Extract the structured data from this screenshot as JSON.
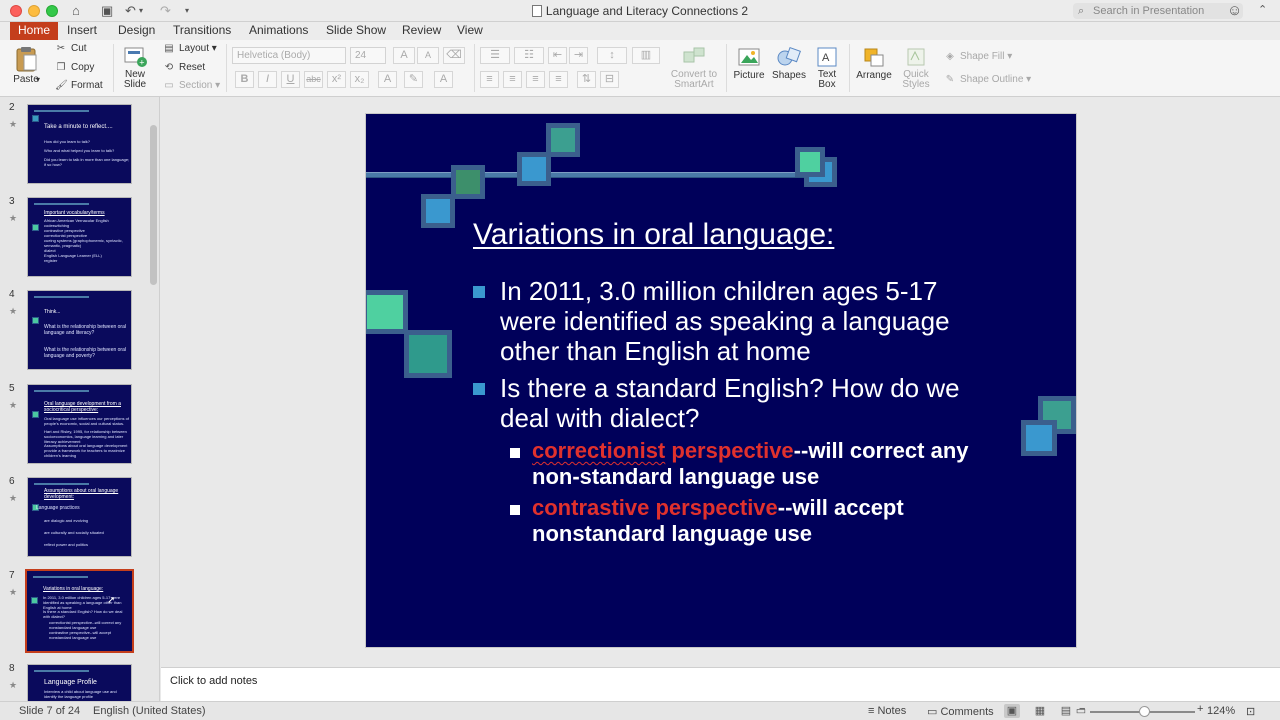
{
  "window": {
    "title": "Language and Literacy Connections 2",
    "search_placeholder": "Search in Presentation"
  },
  "tabs": [
    "Home",
    "Insert",
    "Design",
    "Transitions",
    "Animations",
    "Slide Show",
    "Review",
    "View"
  ],
  "ribbon": {
    "paste": "Paste",
    "cut": "Cut",
    "copy": "Copy",
    "format": "Format",
    "new_slide": "New\nSlide",
    "new_slide_l1": "New",
    "new_slide_l2": "Slide",
    "layout": "Layout",
    "reset": "Reset",
    "section": "Section",
    "font_name": "Helvetica (Body)",
    "font_size": "24",
    "convert_smartart_l1": "Convert to",
    "convert_smartart_l2": "SmartArt",
    "picture": "Picture",
    "shapes": "Shapes",
    "text_box_l1": "Text",
    "text_box_l2": "Box",
    "arrange": "Arrange",
    "quick_styles_l1": "Quick",
    "quick_styles_l2": "Styles",
    "shape_fill": "Shape Fill",
    "shape_outline": "Shape Outline"
  },
  "thumbnails": [
    {
      "num": "2",
      "title": "Take a minute to reflect....",
      "lines": [
        "How did you learn to talk?",
        "Who and what helped you learn to talk?",
        "Did you learn to talk in more than one language; if so how?"
      ]
    },
    {
      "num": "3",
      "title": "Important vocabulary/terms",
      "lines": [
        "African American Vernacular English",
        "codeswitching",
        "contrastive perspective",
        "correctionist perspective",
        "cueing systems (graphophonemic, syntactic, semantic, pragmatic)",
        "dialect",
        "English Language Learner (ELL)",
        "register"
      ]
    },
    {
      "num": "4",
      "title": "Think...",
      "lines": [
        "What is the relationship between oral language and literacy?",
        "What is the relationship between oral language and poverty?"
      ]
    },
    {
      "num": "5",
      "title": "Oral language development from a sociocritical perspective:",
      "lines": [
        "Oral language use influences our perceptions of people's economic, social and cultural status.",
        "Hart and Risley, 1995, for relationship between socioeconomics, language learning and later literacy achievement",
        "Assumptions about oral language development provide a framework for teachers to maximize children's learning"
      ]
    },
    {
      "num": "6",
      "title": "Assumptions about oral language development:",
      "lines": [
        "Language practices",
        "are dialogic and evolving",
        "are culturally and socially situated",
        "reflect power and politics"
      ]
    },
    {
      "num": "7",
      "title": "Variations in oral language:",
      "lines": [
        "In 2011, 3.0 million children ages 5-17 were identified as speaking a language other than English at home",
        "Is there a standard English? How do we deal with dialect?",
        "correctionist perspective--will correct any nonstandard language use",
        "contrastive perspective--will accept nonstandard language use"
      ]
    },
    {
      "num": "8",
      "title": "Language Profile",
      "lines": [
        "Interview a child about language use and identify the language profile"
      ]
    }
  ],
  "slide": {
    "title": "Variations in oral language:",
    "bullets": [
      "In 2011, 3.0 million children ages 5-17 were identified as speaking a language other than English at home",
      "Is there a standard English? How do we deal with dialect?"
    ],
    "sub_bullets": [
      {
        "highlight_1": "correctionist",
        "highlight_2": " perspective",
        "rest": "--will correct any non-standard language use"
      },
      {
        "highlight_1": "contrastive perspective",
        "highlight_2": "",
        "rest": "--will accept nonstandard language use"
      }
    ]
  },
  "notes_placeholder": "Click to add notes",
  "status": {
    "slide_of": "Slide 7 of 24",
    "language": "English (United States)",
    "notes": "Notes",
    "comments": "Comments",
    "zoom": "124%",
    "zoom_level_fraction": 0.5
  },
  "colors": {
    "accent": "#c43e1c",
    "slide_bg": "#00005a",
    "highlight_red": "#e0312d",
    "bullet_blue": "#3a98cf"
  },
  "icons": [
    "close-icon",
    "minimize-icon",
    "maximize-icon",
    "save-icon",
    "undo-icon",
    "redo-icon",
    "search-icon",
    "smiley-icon",
    "paste-icon",
    "cut-icon",
    "copy-icon",
    "format-painter-icon",
    "picture-icon",
    "shapes-icon",
    "text-box-icon",
    "arrange-icon",
    "quick-styles-icon"
  ]
}
